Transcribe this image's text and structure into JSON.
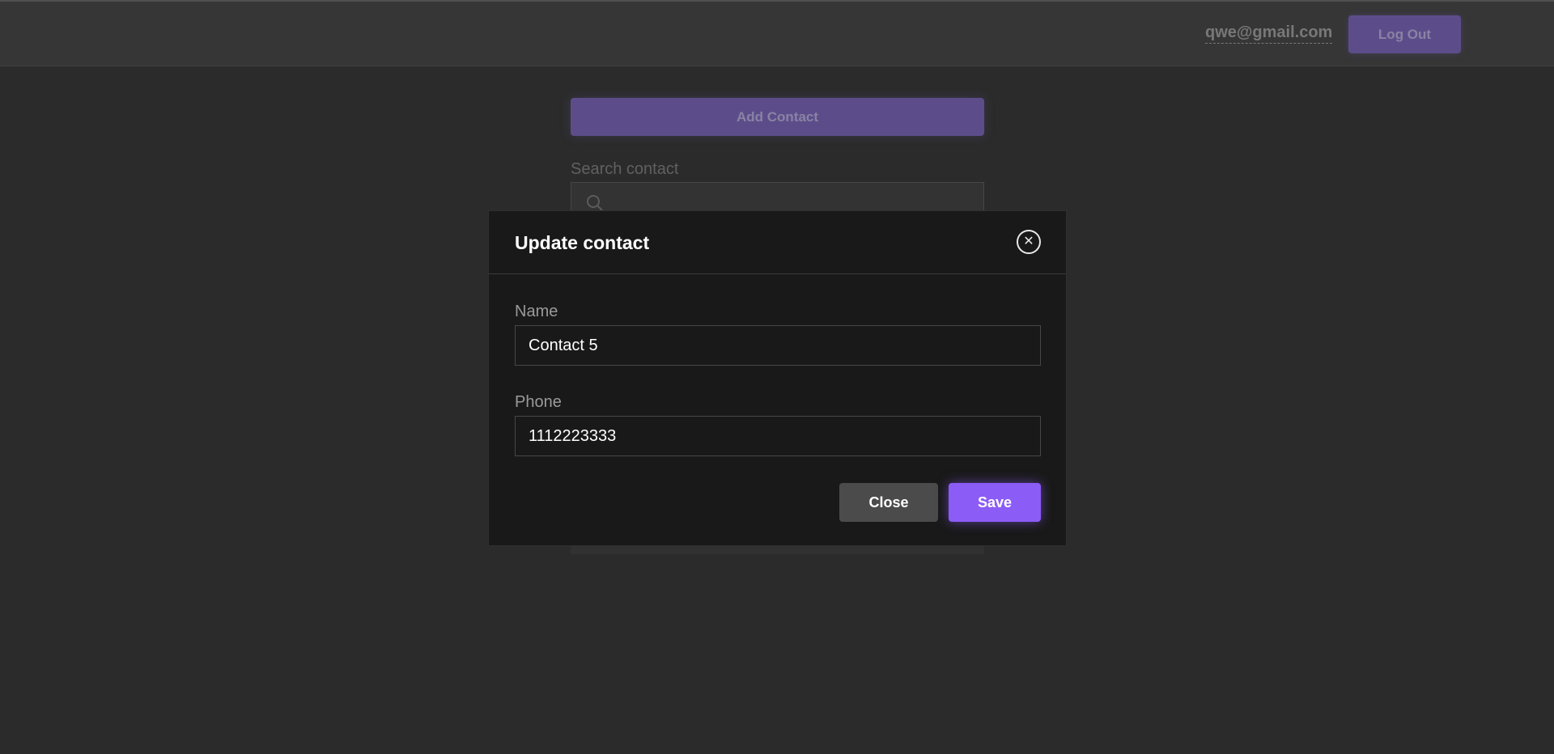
{
  "header": {
    "user_email": "qwe@gmail.com",
    "logout_label": "Log Out"
  },
  "main": {
    "add_contact_label": "Add Contact",
    "search_label": "Search contact",
    "search_value": ""
  },
  "modal": {
    "title": "Update contact",
    "close_icon": "close-circle-icon",
    "name_label": "Name",
    "name_value": "Contact 5",
    "phone_label": "Phone",
    "phone_value": "1112223333",
    "close_label": "Close",
    "save_label": "Save"
  },
  "colors": {
    "accent": "#8c5cf6",
    "accent_dim": "#7b67b9",
    "modal_bg": "#191919",
    "page_bg": "#3a3a3a"
  }
}
